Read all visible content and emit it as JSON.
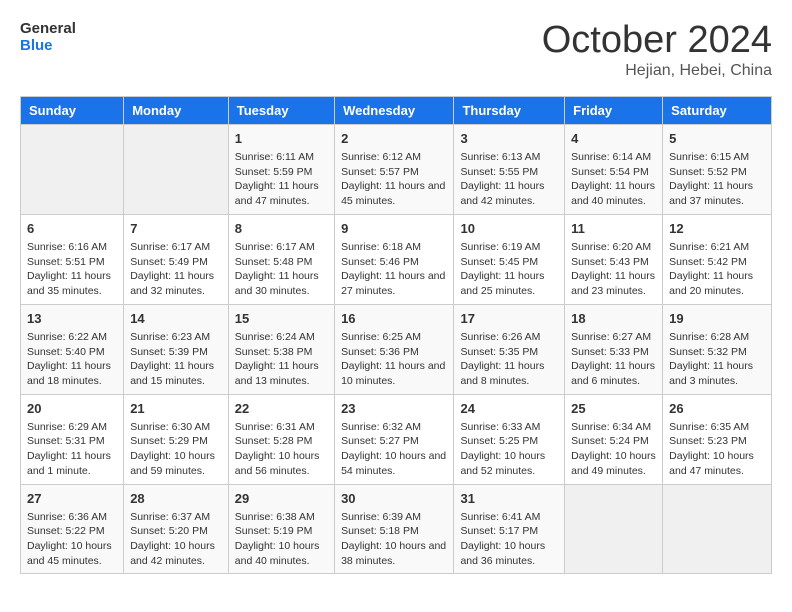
{
  "logo": {
    "line1": "General",
    "line2": "Blue"
  },
  "title": "October 2024",
  "subtitle": "Hejian, Hebei, China",
  "weekdays": [
    "Sunday",
    "Monday",
    "Tuesday",
    "Wednesday",
    "Thursday",
    "Friday",
    "Saturday"
  ],
  "weeks": [
    [
      {
        "day": "",
        "info": ""
      },
      {
        "day": "",
        "info": ""
      },
      {
        "day": "1",
        "info": "Sunrise: 6:11 AM\nSunset: 5:59 PM\nDaylight: 11 hours and 47 minutes."
      },
      {
        "day": "2",
        "info": "Sunrise: 6:12 AM\nSunset: 5:57 PM\nDaylight: 11 hours and 45 minutes."
      },
      {
        "day": "3",
        "info": "Sunrise: 6:13 AM\nSunset: 5:55 PM\nDaylight: 11 hours and 42 minutes."
      },
      {
        "day": "4",
        "info": "Sunrise: 6:14 AM\nSunset: 5:54 PM\nDaylight: 11 hours and 40 minutes."
      },
      {
        "day": "5",
        "info": "Sunrise: 6:15 AM\nSunset: 5:52 PM\nDaylight: 11 hours and 37 minutes."
      }
    ],
    [
      {
        "day": "6",
        "info": "Sunrise: 6:16 AM\nSunset: 5:51 PM\nDaylight: 11 hours and 35 minutes."
      },
      {
        "day": "7",
        "info": "Sunrise: 6:17 AM\nSunset: 5:49 PM\nDaylight: 11 hours and 32 minutes."
      },
      {
        "day": "8",
        "info": "Sunrise: 6:17 AM\nSunset: 5:48 PM\nDaylight: 11 hours and 30 minutes."
      },
      {
        "day": "9",
        "info": "Sunrise: 6:18 AM\nSunset: 5:46 PM\nDaylight: 11 hours and 27 minutes."
      },
      {
        "day": "10",
        "info": "Sunrise: 6:19 AM\nSunset: 5:45 PM\nDaylight: 11 hours and 25 minutes."
      },
      {
        "day": "11",
        "info": "Sunrise: 6:20 AM\nSunset: 5:43 PM\nDaylight: 11 hours and 23 minutes."
      },
      {
        "day": "12",
        "info": "Sunrise: 6:21 AM\nSunset: 5:42 PM\nDaylight: 11 hours and 20 minutes."
      }
    ],
    [
      {
        "day": "13",
        "info": "Sunrise: 6:22 AM\nSunset: 5:40 PM\nDaylight: 11 hours and 18 minutes."
      },
      {
        "day": "14",
        "info": "Sunrise: 6:23 AM\nSunset: 5:39 PM\nDaylight: 11 hours and 15 minutes."
      },
      {
        "day": "15",
        "info": "Sunrise: 6:24 AM\nSunset: 5:38 PM\nDaylight: 11 hours and 13 minutes."
      },
      {
        "day": "16",
        "info": "Sunrise: 6:25 AM\nSunset: 5:36 PM\nDaylight: 11 hours and 10 minutes."
      },
      {
        "day": "17",
        "info": "Sunrise: 6:26 AM\nSunset: 5:35 PM\nDaylight: 11 hours and 8 minutes."
      },
      {
        "day": "18",
        "info": "Sunrise: 6:27 AM\nSunset: 5:33 PM\nDaylight: 11 hours and 6 minutes."
      },
      {
        "day": "19",
        "info": "Sunrise: 6:28 AM\nSunset: 5:32 PM\nDaylight: 11 hours and 3 minutes."
      }
    ],
    [
      {
        "day": "20",
        "info": "Sunrise: 6:29 AM\nSunset: 5:31 PM\nDaylight: 11 hours and 1 minute."
      },
      {
        "day": "21",
        "info": "Sunrise: 6:30 AM\nSunset: 5:29 PM\nDaylight: 10 hours and 59 minutes."
      },
      {
        "day": "22",
        "info": "Sunrise: 6:31 AM\nSunset: 5:28 PM\nDaylight: 10 hours and 56 minutes."
      },
      {
        "day": "23",
        "info": "Sunrise: 6:32 AM\nSunset: 5:27 PM\nDaylight: 10 hours and 54 minutes."
      },
      {
        "day": "24",
        "info": "Sunrise: 6:33 AM\nSunset: 5:25 PM\nDaylight: 10 hours and 52 minutes."
      },
      {
        "day": "25",
        "info": "Sunrise: 6:34 AM\nSunset: 5:24 PM\nDaylight: 10 hours and 49 minutes."
      },
      {
        "day": "26",
        "info": "Sunrise: 6:35 AM\nSunset: 5:23 PM\nDaylight: 10 hours and 47 minutes."
      }
    ],
    [
      {
        "day": "27",
        "info": "Sunrise: 6:36 AM\nSunset: 5:22 PM\nDaylight: 10 hours and 45 minutes."
      },
      {
        "day": "28",
        "info": "Sunrise: 6:37 AM\nSunset: 5:20 PM\nDaylight: 10 hours and 42 minutes."
      },
      {
        "day": "29",
        "info": "Sunrise: 6:38 AM\nSunset: 5:19 PM\nDaylight: 10 hours and 40 minutes."
      },
      {
        "day": "30",
        "info": "Sunrise: 6:39 AM\nSunset: 5:18 PM\nDaylight: 10 hours and 38 minutes."
      },
      {
        "day": "31",
        "info": "Sunrise: 6:41 AM\nSunset: 5:17 PM\nDaylight: 10 hours and 36 minutes."
      },
      {
        "day": "",
        "info": ""
      },
      {
        "day": "",
        "info": ""
      }
    ]
  ]
}
